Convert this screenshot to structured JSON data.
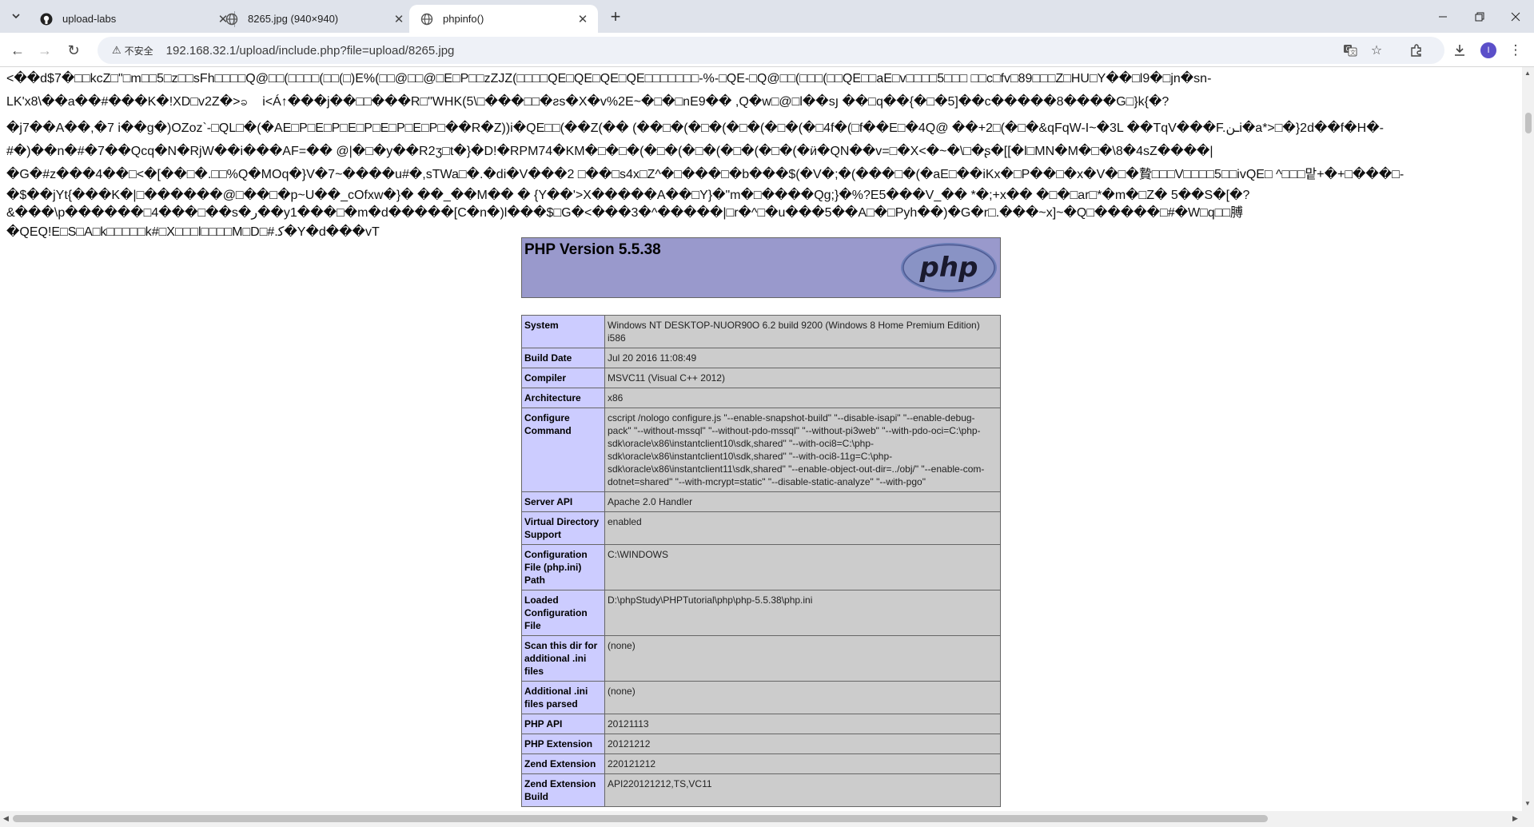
{
  "browser": {
    "tabs": [
      {
        "title": "upload-labs",
        "favicon": "github-icon",
        "active": false
      },
      {
        "title": "8265.jpg (940×940)",
        "favicon": "globe-icon",
        "active": false
      },
      {
        "title": "phpinfo()",
        "favicon": "globe-icon",
        "active": true
      }
    ],
    "security_label": "不安全",
    "url": "192.168.32.1/upload/include.php?file=upload/8265.jpg",
    "avatar_initial": "I"
  },
  "page": {
    "garbage_lines": [
      "<��d$7�□□kcZ□\"□m□□5□z□□sFh□□□□Q@□□(□□□□(□□(□)E%(□□@□□@□E□P□□zZJZ(□□□□QE□QE□QE□QE□□□□□□□-%-□QE-□Q@□□(□□□(□□QE□□aE□v□□□□5□□□ □□c□fv□89□□□Z□HU□Y��□l9�□jn�sn-",
      "LK'x8\\��a��#���K�!XD□v2Z�>ခ��i<Á↑���j��□□���R□\"WHK(5\\□���□□�ƨs�X�v%2E~�□�□nE9�� ,Q�w□@□l��sյ ��□q��{�□�5]��c�����8����G□}k{�?",
      "�j7��A��,�7 i��g�)OZoz`-□QL□�(�AE□P□E□P□E□P□E□P□E□P□��R�Z))i�QE□□(��Z(�� (��□�(�□�(�□�(�□�(�□4f�(□f��E□�4Q@ ��+2□(�□�&qFqW-I~�3L ��TqV���F.ـنi�a*>□�}2d��f�H�-",
      "#�)��n�#�7��Qcq�N�RjW��i���AF=�� @|�□�y��R2ʒ□t�}�D!�RPM74�KM�□�□�(�□�(�□�(�□�(�□�(�ӥ�QN��v=□�X<�~�\\□�ʂ�[[�l□MN�M�□�\\8�4sZ����|",
      "�G�#z���4��□<�[��□�.□□%Q�MOq�}V�7~����u#�,sTWa□�.�di�V���2 □��□s4x□Z^�□���□�b���$(�V�;�(���□�(�aE□��iKx�□P��□�x�V�□�贄□□□V□□□□5□□ivQE□ ^□□□맡+�+□���□-",
      "�$��jYt{���K�|□������@□��□�p~U��_cOfxw�}� ��_��M�� � {Y��'>X�����A��□Y}�\"m�□����Qg;}�%?E5���V_�� *�;+x�� �□�□ar□*�m�□Z� 5��S�[�?",
      "&���\\p������□4���□��s�ﺭ��y1���□�m�d�����[C�n�)l���$□G�<���3�^�����|□r�^□�u���5��A□�□Pyh��)�G�r□.���~x]~�Q□�����□#�W□q□□膊",
      "�QEQ!E□S□A□k□□□□□k#□X□□□l□□□□M□D□#.ﮐ�Y�d���vT"
    ],
    "php_version": "PHP Version 5.5.38",
    "php_logo_text": "php",
    "info_rows": [
      {
        "key": "System",
        "value": "Windows NT DESKTOP-NUOR90O 6.2 build 9200 (Windows 8 Home Premium Edition) i586"
      },
      {
        "key": "Build Date",
        "value": "Jul 20 2016 11:08:49"
      },
      {
        "key": "Compiler",
        "value": "MSVC11 (Visual C++ 2012)"
      },
      {
        "key": "Architecture",
        "value": "x86"
      },
      {
        "key": "Configure Command",
        "value": "cscript /nologo configure.js \"--enable-snapshot-build\" \"--disable-isapi\" \"--enable-debug-pack\" \"--without-mssql\" \"--without-pdo-mssql\" \"--without-pi3web\" \"--with-pdo-oci=C:\\php-sdk\\oracle\\x86\\instantclient10\\sdk,shared\" \"--with-oci8=C:\\php-sdk\\oracle\\x86\\instantclient10\\sdk,shared\" \"--with-oci8-11g=C:\\php-sdk\\oracle\\x86\\instantclient11\\sdk,shared\" \"--enable-object-out-dir=../obj/\" \"--enable-com-dotnet=shared\" \"--with-mcrypt=static\" \"--disable-static-analyze\" \"--with-pgo\""
      },
      {
        "key": "Server API",
        "value": "Apache 2.0 Handler"
      },
      {
        "key": "Virtual Directory Support",
        "value": "enabled"
      },
      {
        "key": "Configuration File (php.ini) Path",
        "value": "C:\\WINDOWS"
      },
      {
        "key": "Loaded Configuration File",
        "value": "D:\\phpStudy\\PHPTutorial\\php\\php-5.5.38\\php.ini"
      },
      {
        "key": "Scan this dir for additional .ini files",
        "value": "(none)"
      },
      {
        "key": "Additional .ini files parsed",
        "value": "(none)"
      },
      {
        "key": "PHP API",
        "value": "20121113"
      },
      {
        "key": "PHP Extension",
        "value": "20121212"
      },
      {
        "key": "Zend Extension",
        "value": "220121212"
      },
      {
        "key": "Zend Extension Build",
        "value": "API220121212,TS,VC11"
      }
    ]
  }
}
